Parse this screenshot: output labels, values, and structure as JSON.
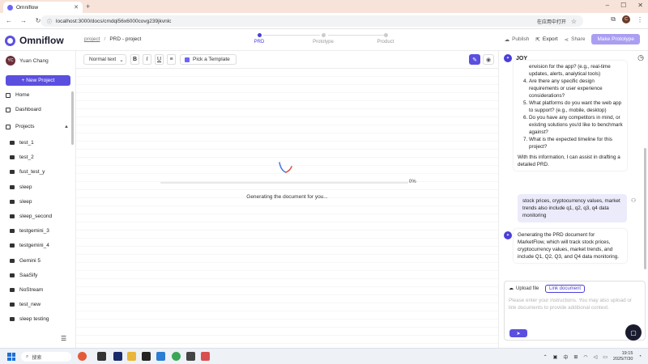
{
  "browser": {
    "tab_title": "Omniflow",
    "url": "localhost:3000/docs/cmdql56x6000covg239jkvnlc",
    "open_in_app": "在应用中打开",
    "profile_initial": "C"
  },
  "header": {
    "logo_text": "Omniflow",
    "breadcrumb": {
      "root": "project",
      "sep": "/",
      "current": "PRD - project"
    },
    "steps": [
      {
        "label": "PRD",
        "active": true
      },
      {
        "label": "Prototype",
        "active": false
      },
      {
        "label": "Product",
        "active": false
      }
    ],
    "actions": {
      "publish": "Publish",
      "export": "Export",
      "share": "Share",
      "make_prototype": "Make Prototype"
    }
  },
  "sidebar": {
    "user": {
      "initials": "YC",
      "name": "Yuan Chang"
    },
    "new_project": "+ New Project",
    "nav": [
      {
        "label": "Home",
        "icon": "home-icon"
      },
      {
        "label": "Dashboard",
        "icon": "dashboard-icon"
      },
      {
        "label": "Projects",
        "icon": "projects-icon"
      }
    ],
    "projects": [
      "test_1",
      "test_2",
      "fust_test_y",
      "sleep",
      "sleep",
      "sleep_second",
      "testgemini_3",
      "testgemini_4",
      "Gemini 5",
      "SaaSify",
      "NoStream",
      "test_new",
      "sleep testing"
    ]
  },
  "editor": {
    "format_select": "Normal text",
    "bold": "B",
    "italic": "I",
    "underline": "U",
    "list": "≡",
    "template_button": "Pick a Template",
    "progress_percent": 0,
    "progress_label": "0%",
    "status_text": "Generating the document for you..."
  },
  "chat": {
    "bot_name": "JOY",
    "message_1_partial": "envision for the app? (e.g., real-time updates, alerts, analytical tools)",
    "message_1_items": [
      "Are there any specific design requirements or user experience considerations?",
      "What platforms do you want the web app to support? (e.g., mobile, desktop)",
      "Do you have any competitors in mind, or existing solutions you'd like to benchmark against?",
      "What is the expected timeline for this project?"
    ],
    "message_1_footer": "With this information, I can assist in drafting a detailed PRD.",
    "user_message": "stock prices, cryptocurrency values, market trends also include q1, q2, q3, q4 data monitoring",
    "bot_reply": "Generating the PRD document for MarketFlow, which will track stock prices, cryptocurrency values, market trends, and include Q1, Q2, Q3, and Q4 data monitoring.",
    "upload_label": "Upload file",
    "link_document": "Link document",
    "input_placeholder": "Please enter your instructions. You may also upload or link documents to provide additional context."
  },
  "taskbar": {
    "search": "搜索",
    "ime": "中",
    "time": "19:15",
    "date": "2025/7/30"
  }
}
